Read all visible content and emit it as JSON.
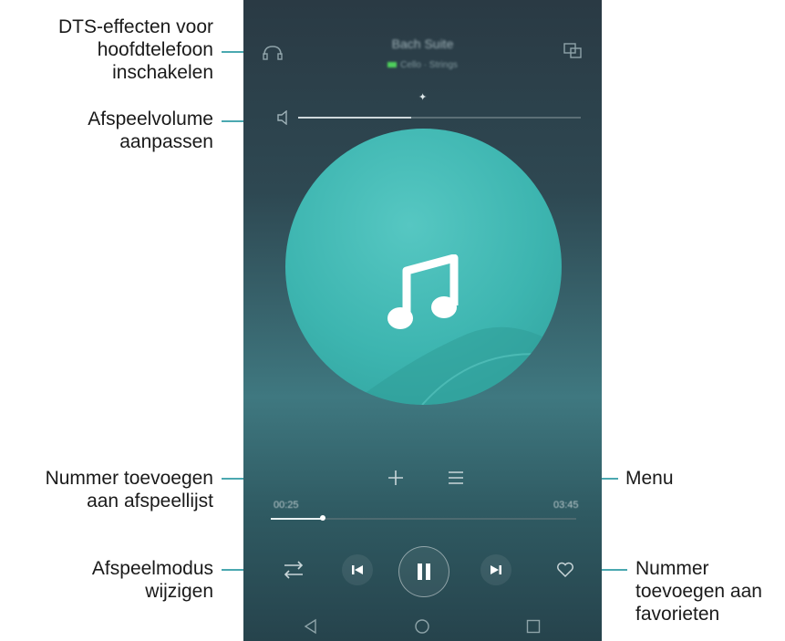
{
  "annotations": {
    "dts": [
      "DTS-effecten voor",
      "hoofdtelefoon",
      "inschakelen"
    ],
    "volume": [
      "Afspeelvolume",
      "aanpassen"
    ],
    "add_playlist": [
      "Nummer toevoegen",
      "aan afspeellijst"
    ],
    "play_mode": [
      "Afspeelmodus",
      "wijzigen"
    ],
    "menu": [
      "Menu"
    ],
    "favorite": [
      "Nummer",
      "toevoegen aan",
      "favorieten"
    ]
  },
  "player": {
    "title": "Bach Suite",
    "subtitle": "Cello · Strings",
    "elapsed": "00:25",
    "duration": "03:45",
    "progress_fraction": 0.17,
    "volume_fraction": 0.4
  },
  "icons": [
    "dts-icon",
    "cast-icon",
    "volume-icon",
    "music-note-icon",
    "add-icon",
    "menu-icon",
    "play-mode-icon",
    "previous-icon",
    "pause-icon",
    "next-icon",
    "heart-icon",
    "back-icon",
    "home-icon",
    "recents-icon"
  ],
  "colors": {
    "accent": "#4aa8b0",
    "album": "#3db5b0"
  }
}
